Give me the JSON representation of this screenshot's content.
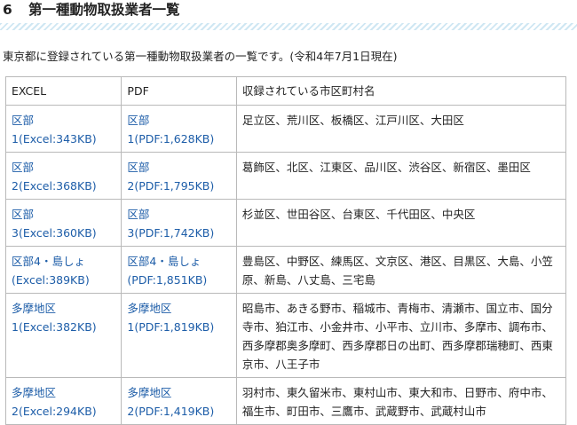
{
  "section": {
    "number": "6",
    "title": "第一種動物取扱業者一覧"
  },
  "intro": "東京都に登録されている第一種動物取扱業者の一覧です。(令和4年7月1日現在)",
  "table": {
    "headers": [
      "EXCEL",
      "PDF",
      "収録されている市区町村名"
    ],
    "rows": [
      {
        "excel": "区部\n1(Excel:343KB)",
        "pdf": "区部\n1(PDF:1,628KB)",
        "areas": "足立区、荒川区、板橋区、江戸川区、大田区"
      },
      {
        "excel": "区部\n2(Excel:368KB)",
        "pdf": "区部\n2(PDF:1,795KB)",
        "areas": "葛飾区、北区、江東区、品川区、渋谷区、新宿区、墨田区"
      },
      {
        "excel": "区部\n3(Excel:360KB)",
        "pdf": "区部\n3(PDF:1,742KB)",
        "areas": "杉並区、世田谷区、台東区、千代田区、中央区"
      },
      {
        "excel": "区部4・島しょ\n(Excel:389KB)",
        "pdf": "区部4・島しょ\n(PDF:1,851KB)",
        "areas": "豊島区、中野区、練馬区、文京区、港区、目黒区、大島、小笠原、新島、八丈島、三宅島"
      },
      {
        "excel": "多摩地区\n1(Excel:382KB)",
        "pdf": "多摩地区\n1(PDF:1,819KB)",
        "areas": "昭島市、あきる野市、稲城市、青梅市、清瀬市、国立市、国分寺市、狛江市、小金井市、小平市、立川市、多摩市、調布市、西多摩郡奥多摩町、西多摩郡日の出町、西多摩郡瑞穂町、西東京市、八王子市"
      },
      {
        "excel": "多摩地区\n2(Excel:294KB)",
        "pdf": "多摩地区\n2(PDF:1,419KB)",
        "areas": "羽村市、東久留米市、東村山市、東大和市、日野市、府中市、福生市、町田市、三鷹市、武蔵野市、武蔵村山市"
      }
    ]
  },
  "colors": {
    "link": "#1d5da8",
    "stripe": "#cfe7f3",
    "border": "#b9b9b9"
  }
}
